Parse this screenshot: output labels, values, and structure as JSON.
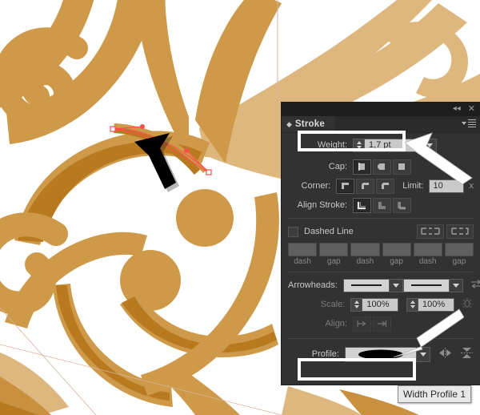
{
  "app": {
    "panel_title": "Stroke",
    "topbar": {
      "collapse_icon": "double-left-arrow-icon",
      "close_icon": "close-icon"
    },
    "menu_icon": "panel-menu-icon"
  },
  "panel": {
    "weight": {
      "label": "Weight:",
      "value": "1,7 pt",
      "stepper_icon": "stepper-updown-icon",
      "dropdown_icon": "chevron-down-icon"
    },
    "cap": {
      "label": "Cap:",
      "options": [
        "butt-cap-icon",
        "round-cap-icon",
        "projecting-cap-icon"
      ],
      "selected_index": 0
    },
    "corner": {
      "label": "Corner:",
      "options": [
        "miter-join-icon",
        "round-join-icon",
        "bevel-join-icon"
      ],
      "selected_index": 0,
      "limit_label": "Limit:",
      "limit_value": "10",
      "limit_unit": "x"
    },
    "align_stroke": {
      "label": "Align Stroke:",
      "options": [
        "align-center-icon",
        "align-inside-icon",
        "align-outside-icon"
      ],
      "selected_index": 0
    },
    "dashed_line": {
      "label": "Dashed Line",
      "checked": false,
      "cap_options": [
        "dash-preserve-icon",
        "dash-adjust-icon"
      ],
      "fields": [
        "",
        "",
        "",
        "",
        "",
        ""
      ],
      "field_labels": [
        "dash",
        "gap",
        "dash",
        "gap",
        "dash",
        "gap"
      ]
    },
    "arrowheads": {
      "label": "Arrowheads:",
      "start_value": "none-arrowhead",
      "end_value": "none-arrowhead",
      "swap_icon": "swap-arrowheads-icon",
      "dropdown_icon": "chevron-down-icon"
    },
    "scale": {
      "label": "Scale:",
      "start_value": "100%",
      "end_value": "100%",
      "link_icon": "link-scale-icon"
    },
    "align": {
      "label": "Align:",
      "options": [
        "extend-arrowhead-icon",
        "place-arrowhead-icon"
      ]
    },
    "profile": {
      "label": "Profile:",
      "value": "width-profile-1-shape",
      "dropdown_icon": "chevron-down-icon",
      "flip_along_icon": "flip-along-icon",
      "flip_across_icon": "flip-across-icon"
    }
  },
  "tooltip": {
    "text": "Width Profile 1"
  },
  "annotations": {
    "highlight_color": "#ffffff",
    "arrow_color": "#ffffff",
    "selection_color": "#ff4d4d",
    "pointer_icon": "black-arrow-pointer"
  },
  "artwork": {
    "background": "#ffffff",
    "gold_dark": "#c8903f",
    "gold_mid": "#cf9b4a",
    "gold_light": "#ddb77e",
    "shade": "#b8791f",
    "artboard_edge": "#d8b2a0"
  }
}
